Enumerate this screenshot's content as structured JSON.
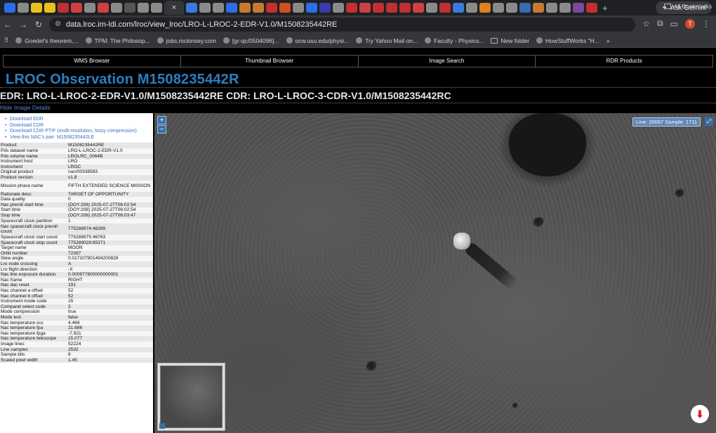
{
  "browser": {
    "tab_colors": [
      "#2d6ee8",
      "#8a8a8a",
      "#e8c020",
      "#e8c020",
      "#c03030",
      "#d04040",
      "#8a8a8a",
      "#d04040",
      "#8a8a8a",
      "#555",
      "#8a8a8a",
      "#8a8a8a",
      "#3a7ae0",
      "#8a8a8a",
      "#8a8a8a",
      "#2d6ee8",
      "#c77a30",
      "#c77a30",
      "#c03030",
      "#d05020",
      "#8a8a8a",
      "#2d6ee8",
      "#3a3ab0",
      "#8a8a8a",
      "#c03030",
      "#d04040",
      "#c03030",
      "#c03030",
      "#c03030",
      "#d04040",
      "#8a8a8a",
      "#c03030",
      "#3a7ae0",
      "#8a8a8a",
      "#e08020",
      "#8a8a8a",
      "#8a8a8a",
      "#3a6ab0",
      "#c77a30",
      "#8a8a8a",
      "#8a8a8a",
      "#7a4aa0",
      "#c03030"
    ],
    "active_tab_close": "×",
    "new_tab": "+",
    "gemini_label": "Ask Gemini",
    "url": "data.lroc.im-ldi.com/lroc/view_lroc/LRO-L-LROC-2-EDR-V1.0/M1508235442RE",
    "avatar_letter": "T",
    "bookmarks": [
      "Goedel's theorem,...",
      "TPM: The Philosop...",
      "jobs.mckinsey.com",
      "[gr-qc/0504096]...",
      "ocw.usu.edu/physi...",
      "Try Yahoo Mail on...",
      "Faculty - Physics...",
      "New folder",
      "HowStuffWorks \"H..."
    ],
    "more_bookmarks": "»",
    "all_bookmarks": "All Bookmarks"
  },
  "nav": {
    "wms": "WMS Browser",
    "thumb": "Thumbnail Browser",
    "search": "Image Search",
    "rdr": "RDR Products"
  },
  "page": {
    "title": "LROC Observation M1508235442R",
    "edr_cdr": "EDR: LRO-L-LROC-2-EDR-V1.0/M1508235442RE CDR: LRO-L-LROC-3-CDR-V1.0/M1508235442RC",
    "hide_details": "Hide Image Details"
  },
  "downloads": [
    "Download EDR",
    "Download CDR",
    "Download CDR PTIF (multi-resolution, lossy compression)",
    "View this NAC's pair: M1508235442LE"
  ],
  "properties": [
    {
      "k": "Product",
      "v": "M1508235442RE"
    },
    {
      "k": "Pds dataset name",
      "v": "LRO-L-LROC-2-EDR-V1.0"
    },
    {
      "k": "Pds volume name",
      "v": "LROLRC_0064B"
    },
    {
      "k": "Instrument host",
      "v": "LRO"
    },
    {
      "k": "Instrument",
      "v": "LROC"
    },
    {
      "k": "Original product",
      "v": "nacr00338583"
    },
    {
      "k": "Product version",
      "v": "v1.8"
    },
    {
      "k": "Mission phase name",
      "v": "FIFTH EXTENDED SCIENCE MISSION",
      "tall": true
    },
    {
      "k": "Rationale desc",
      "v": "TARGET OF OPPORTUNITY"
    },
    {
      "k": "Data quality",
      "v": "0"
    },
    {
      "k": "Nac preroll start time",
      "v": "(DOY:208) 2025-07-27T06:02:54"
    },
    {
      "k": "Start time",
      "v": "(DOY:208) 2025-07-27T06:02:54"
    },
    {
      "k": "Stop time",
      "v": "(DOY:208) 2025-07-27T06:03:47"
    },
    {
      "k": "Spacecraft clock partition",
      "v": "1"
    },
    {
      "k": "Nac spacecraft clock preroll count",
      "v": "775288974:46399",
      "tall": true
    },
    {
      "k": "Spacecraft clock start count",
      "v": "775288975:46763"
    },
    {
      "k": "Spacecraft clock stop count",
      "v": "775289028:65371"
    },
    {
      "k": "Target name",
      "v": "MOON"
    },
    {
      "k": "Orbit number",
      "v": "72397"
    },
    {
      "k": "Slew angle",
      "v": "0.017107901494200828"
    },
    {
      "k": "Lro node crossing",
      "v": "A"
    },
    {
      "k": "Lro flight direction",
      "v": "-X"
    },
    {
      "k": "Nac line exposure duration",
      "v": "0.000977600000000001"
    },
    {
      "k": "Nac frame",
      "v": "RIGHT"
    },
    {
      "k": "Nac dac reset",
      "v": "191"
    },
    {
      "k": "Nac channel a offset",
      "v": "52"
    },
    {
      "k": "Nac channel b offset",
      "v": "52"
    },
    {
      "k": "Instrument mode code",
      "v": "15"
    },
    {
      "k": "Compand select code",
      "v": "3"
    },
    {
      "k": "Mode compression",
      "v": "true"
    },
    {
      "k": "Mode test",
      "v": "false"
    },
    {
      "k": "Nac temperature scs",
      "v": "4.466"
    },
    {
      "k": "Nac temperature fpa",
      "v": "21.686"
    },
    {
      "k": "Nac temperature fpga",
      "v": "-7.921"
    },
    {
      "k": "Nac temperature telescope",
      "v": "15.077"
    },
    {
      "k": "Image lines",
      "v": "52224"
    },
    {
      "k": "Line samples",
      "v": "2532"
    },
    {
      "k": "Sample bits",
      "v": "8"
    },
    {
      "k": "Scaled pixel width",
      "v": "1.45"
    }
  ],
  "viewer": {
    "zoom_in": "+",
    "zoom_out": "−",
    "readout": "Line: 20067 Sample: 1711",
    "fullscreen": "⤢",
    "pdf_icon": "pdf-icon"
  }
}
